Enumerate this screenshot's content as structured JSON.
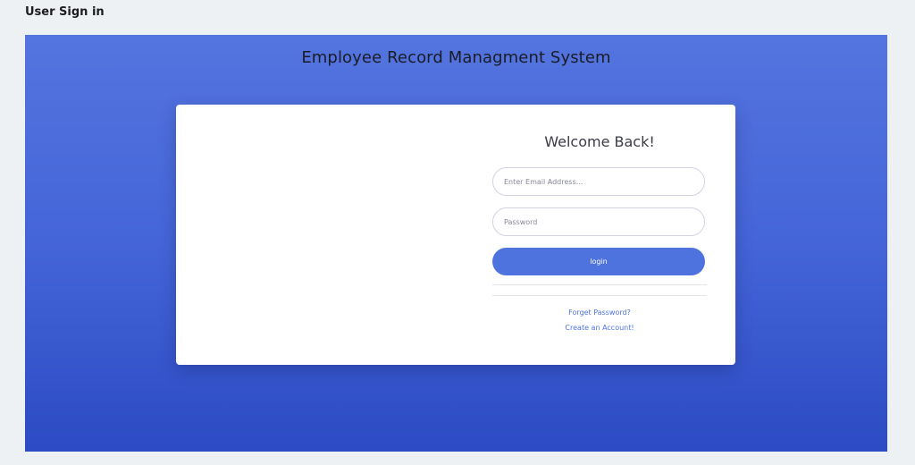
{
  "page": {
    "heading": "User Sign in"
  },
  "hero": {
    "title": "Employee Record Managment System"
  },
  "login_form": {
    "welcome": "Welcome Back!",
    "email_placeholder": "Enter Email Address...",
    "password_placeholder": "Password",
    "login_label": "login",
    "forgot_link": "Forget Password?",
    "create_link": "Create an Account!"
  },
  "colors": {
    "accent": "#4e73df",
    "gradient_top": "#5474df",
    "gradient_bottom": "#2c4bc4",
    "page_background": "#eef1f4"
  }
}
